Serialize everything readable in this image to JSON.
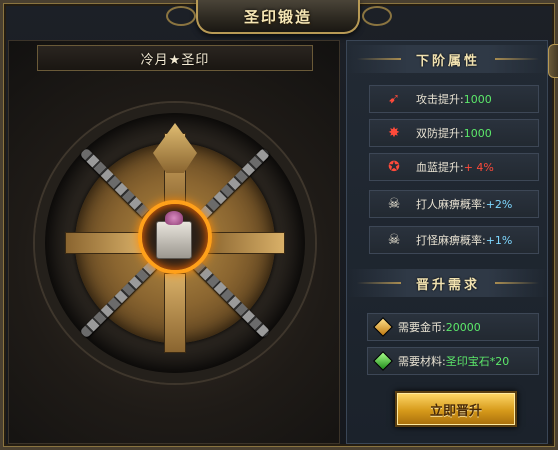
{
  "window": {
    "title": "圣印锻造"
  },
  "seal": {
    "name": "冷月★圣印"
  },
  "next_tier": {
    "heading": "下阶属性",
    "attributes": [
      {
        "icon": "sword-attack-icon",
        "label": "攻击提升:",
        "value": "1000",
        "value_color": "#5ce86a"
      },
      {
        "icon": "defense-wings-icon",
        "label": "双防提升:",
        "value": "1000",
        "value_color": "#5ce86a"
      },
      {
        "icon": "blood-mana-icon",
        "label": "血蓝提升:",
        "value": " + 4%",
        "value_color": "#ff4a3a"
      },
      {
        "icon": "skull-icon",
        "label": "打人麻痹概率:",
        "value": "+2%",
        "value_color": "#7fd8ff"
      },
      {
        "icon": "skull-icon",
        "label": "打怪麻痹概率:",
        "value": "+1%",
        "value_color": "#7fd8ff"
      }
    ]
  },
  "requirements": {
    "heading": "晋升需求",
    "items": [
      {
        "icon": "gold-gem-icon",
        "label": "需要金币:",
        "value": "20000",
        "value_color": "#5ce86a",
        "gem_color": "#e0a020"
      },
      {
        "icon": "green-gem-icon",
        "label": "需要材料:",
        "value": "圣印宝石*20",
        "value_color": "#5ce86a",
        "gem_color": "#3ec83a"
      }
    ]
  },
  "actions": {
    "upgrade_label": "立即晋升"
  }
}
